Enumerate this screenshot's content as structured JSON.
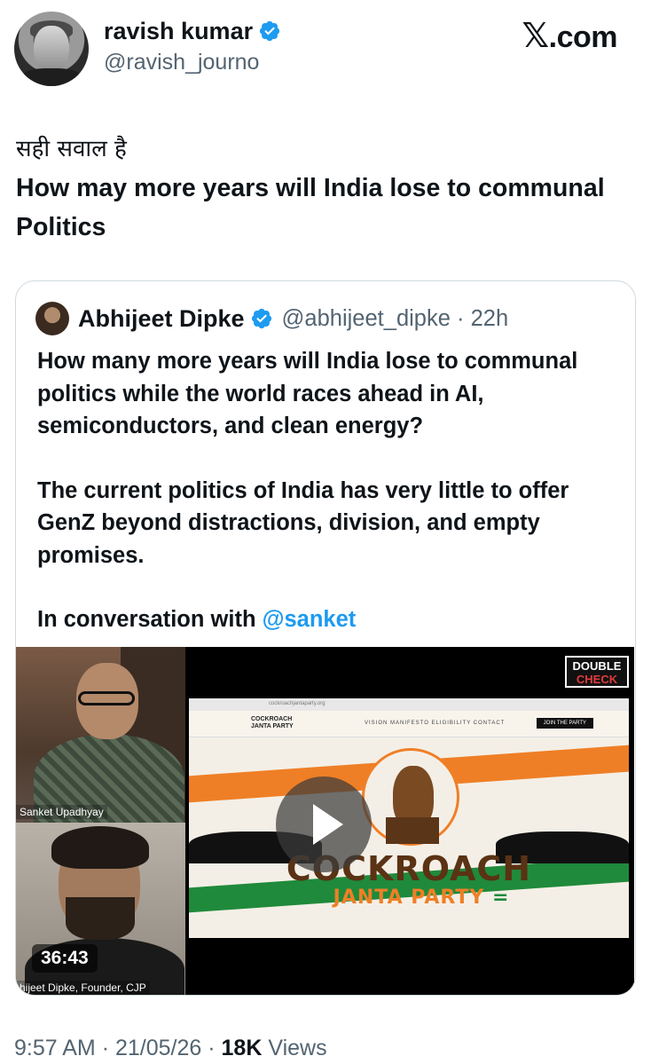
{
  "brand": {
    "label": "X.com",
    "x_glyph": "𝕏",
    "suffix": ".com"
  },
  "author": {
    "name": "ravish kumar",
    "handle": "@ravish_journo",
    "verified_icon": "verified-badge-icon",
    "verified_color": "#1d9bf0"
  },
  "tweet": {
    "line1": "सही सवाल है",
    "line2": "How may more years will India lose to communal Politics"
  },
  "quote": {
    "name": "Abhijeet Dipke",
    "handle": "@abhijeet_dipke",
    "separator": "·",
    "time": "22h",
    "para1": "How many more years will India lose to communal politics while the world races ahead in AI, semiconductors, and clean energy?",
    "para2": "The current politics of India has very little to offer GenZ beyond distractions, division, and empty promises.",
    "para3_prefix": "In conversation with ",
    "para3_mention": "@sanket",
    "video": {
      "duration": "36:43",
      "cam1_label": "Sanket Upadhyay",
      "cam2_label": "hijeet Dipke, Founder, CJP",
      "logo_line1": "DOUBLE",
      "logo_line2": "CHECK",
      "browser_url": "cockroachjantaparty.org",
      "site_brand_line1": "COCKROACH",
      "site_brand_line2": "JANTA PARTY",
      "site_links": "VISION   MANIFESTO   ELIGIBILITY   CONTACT",
      "site_join": "JOIN THE PARTY",
      "banner_title": "COCKROACH",
      "banner_sub": "JANTA PARTY"
    }
  },
  "meta": {
    "time": "9:57 AM",
    "date": "21/05/26",
    "views_count": "18K",
    "views_label": "Views",
    "sep": "·"
  },
  "colors": {
    "link": "#1d9bf0",
    "secondary_text": "#536471",
    "border": "#cfd9de"
  }
}
